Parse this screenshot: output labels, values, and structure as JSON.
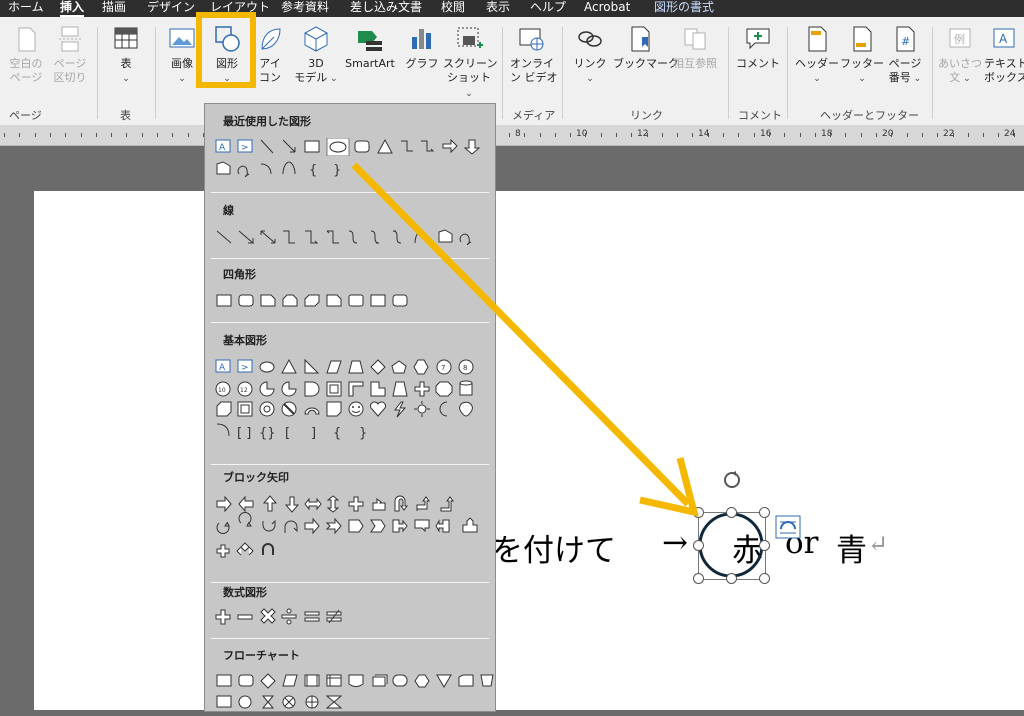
{
  "tabs": [
    "ホーム",
    "挿入",
    "描画",
    "デザイン",
    "レイアウト",
    "参考資料",
    "差し込み文書",
    "校閲",
    "表示",
    "ヘルプ",
    "Acrobat",
    "図形の書式"
  ],
  "active_tab": "挿入",
  "ribbon": {
    "page_group": {
      "cover_l1": "空白の",
      "cover_l2": "ページ",
      "break_l1": "ページ",
      "break_l2": "区切り",
      "name": "ページ"
    },
    "table_group": {
      "table": "表",
      "name": "表"
    },
    "illus": {
      "picture": "画像",
      "shapes": "図形",
      "icons_l1": "アイ",
      "icons_l2": "コン",
      "model_l1": "3D",
      "model_l2": "モデル",
      "smartart": "SmartArt",
      "chart": "グラフ",
      "screenshot_l1": "スクリーン",
      "screenshot_l2": "ショット"
    },
    "media": {
      "video_l1": "オンライ",
      "video_l2": "ン ビデオ",
      "name": "メディア"
    },
    "links": {
      "link": "リンク",
      "bookmark": "ブックマーク",
      "xref": "相互参照",
      "name": "リンク"
    },
    "comments": {
      "comment": "コメント",
      "name": "コメント"
    },
    "hf": {
      "header": "ヘッダー",
      "footer": "フッター",
      "pageno_l1": "ページ",
      "pageno_l2": "番号",
      "name": "ヘッダーとフッター"
    },
    "text": {
      "greeting_l1": "あいさつ",
      "greeting_l2": "文",
      "textbox_l1": "テキスト",
      "textbox_l2": "ボックス"
    },
    "sample_icon_text": "例"
  },
  "ruler_numbers": [
    "8",
    "10",
    "12",
    "14",
    "16",
    "18",
    "20",
    "22",
    "24"
  ],
  "gallery": {
    "sections": [
      "最近使用した図形",
      "線",
      "四角形",
      "基本図形",
      "ブロック矢印",
      "数式図形",
      "フローチャート"
    ]
  },
  "document": {
    "text1": "を付けて",
    "arrow": "→",
    "text2": "赤",
    "text3": "or",
    "text4": "青",
    "para_mark": "↵"
  },
  "colors": {
    "highlight": "#f5b800",
    "arrow": "#f5b800",
    "circle": "#10283c"
  }
}
